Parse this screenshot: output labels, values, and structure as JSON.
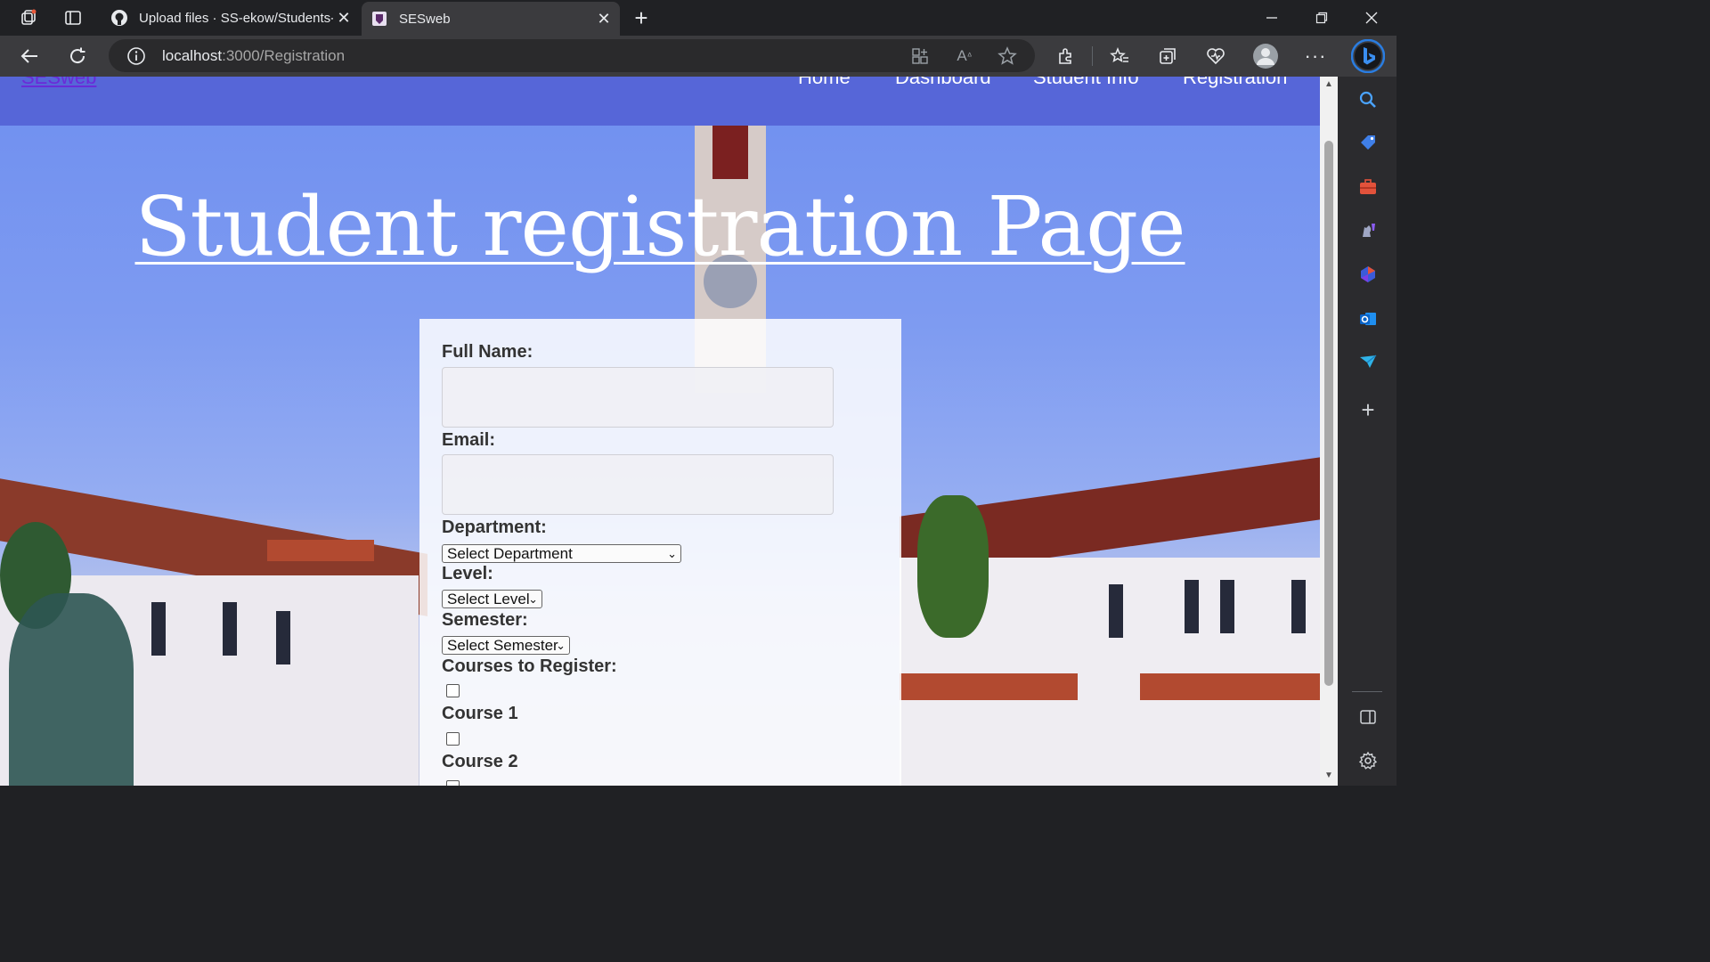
{
  "browser": {
    "tabs": [
      {
        "title": "Upload files · SS-ekow/Students-",
        "active": false
      },
      {
        "title": "SESweb",
        "active": true
      }
    ],
    "address": {
      "host": "localhost",
      "path": ":3000/Registration"
    }
  },
  "site": {
    "brand": "SESweb",
    "menu": [
      "Home",
      "Dashboard",
      "Student Info",
      "Registration"
    ]
  },
  "page": {
    "title": "Student registration Page"
  },
  "form": {
    "full_name_label": "Full Name:",
    "full_name_value": "",
    "email_label": "Email:",
    "email_value": "",
    "department_label": "Department:",
    "department_selected": "Select Department",
    "level_label": "Level:",
    "level_selected": "Select Level",
    "semester_label": "Semester:",
    "semester_selected": "Select Semester",
    "courses_label": "Courses to Register:",
    "courses": [
      {
        "label": "Course 1",
        "checked": false
      },
      {
        "label": "Course 2",
        "checked": false
      }
    ]
  },
  "colors": {
    "header_bg": "#5666d8",
    "brand_link": "#6a2bd8",
    "chrome_bg": "#202124"
  }
}
